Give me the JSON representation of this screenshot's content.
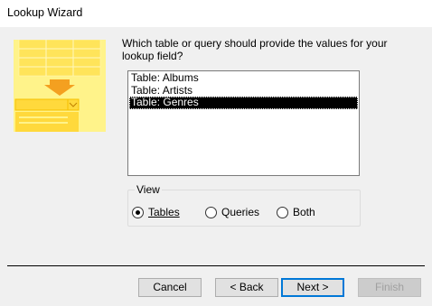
{
  "window": {
    "title": "Lookup Wizard"
  },
  "wizard": {
    "image_icon": "lookup-wizard-illustration",
    "question": "Which table or query should provide the values for your lookup field?"
  },
  "list": {
    "items": [
      "Table: Albums",
      "Table: Artists",
      "Table: Genres"
    ],
    "selected_index": 2
  },
  "view": {
    "label": "View",
    "options": [
      "Tables",
      "Queries",
      "Both"
    ],
    "selected": "Tables"
  },
  "buttons": {
    "cancel": "Cancel",
    "back": "< Back",
    "next": "Next >",
    "finish": "Finish"
  },
  "colors": {
    "art_yellow_light": "#fff38a",
    "art_yellow": "#ffd93c",
    "art_orange": "#f4a020",
    "default_button_border": "#0078d7",
    "selection_bg": "#000000"
  }
}
